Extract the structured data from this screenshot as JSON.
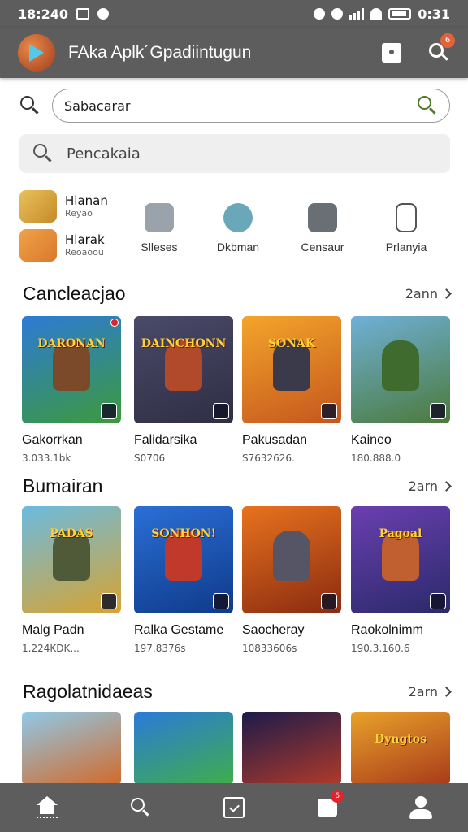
{
  "status_bar": {
    "time": "18:240",
    "right_time": "0:31"
  },
  "app_bar": {
    "title": "FAka Aplk´Gpadiintugun",
    "notification_count": "6"
  },
  "search": {
    "value": "Sabacarar",
    "secondary_placeholder": "Pencakaia"
  },
  "quick_links": [
    {
      "title": "Hlanan",
      "subtitle": "Reyao"
    },
    {
      "title": "Hlarak",
      "subtitle": "Reoaoou"
    }
  ],
  "categories": [
    {
      "label": "Slleses",
      "icon": "tag-icon"
    },
    {
      "label": "Dkbman",
      "icon": "refresh-icon"
    },
    {
      "label": "Censaur",
      "icon": "home-icon"
    },
    {
      "label": "Prlanyia",
      "icon": "tablet-icon"
    }
  ],
  "sections": [
    {
      "title": "Cancleacjao",
      "more": "2ann",
      "items": [
        {
          "name": "Gakorrkan",
          "meta": "3.033.1bk",
          "art_text": "DARONAN",
          "bg1": "#2d7ad6",
          "bg2": "#3c9a3c",
          "hero": "#7a4a2a"
        },
        {
          "name": "Falidarsika",
          "meta": "S0706",
          "art_text": "DAINCHONN",
          "bg1": "#4a4a6a",
          "bg2": "#2e2e44",
          "hero": "#b04a2a"
        },
        {
          "name": "Pakusadan",
          "meta": "S7632626.",
          "art_text": "SONAK",
          "bg1": "#f3a52a",
          "bg2": "#c5561e",
          "hero": "#3a3a4a"
        },
        {
          "name": "Kaineo",
          "meta": "180.888.0",
          "art_text": "",
          "bg1": "#6fb0d8",
          "bg2": "#4b7a3a",
          "hero": "#3f6b2f"
        }
      ]
    },
    {
      "title": "Bumairan",
      "more": "2arn",
      "items": [
        {
          "name": "Malg Padn",
          "meta": "1.224KDK...",
          "art_text": "PADAS",
          "bg1": "#6bbbe0",
          "bg2": "#d8a330",
          "hero": "#4e5a38"
        },
        {
          "name": "Ralka Gestame",
          "meta": "197.8376s",
          "art_text": "SONHON!",
          "bg1": "#2a6fd6",
          "bg2": "#0f3a8a",
          "hero": "#c0392b"
        },
        {
          "name": "Saocheray",
          "meta": "10833606s",
          "art_text": "",
          "bg1": "#e8731e",
          "bg2": "#8a2a10",
          "hero": "#555566"
        },
        {
          "name": "Raokolnimm",
          "meta": "190.3.160.6",
          "art_text": "Pagoal",
          "bg1": "#6a3fb0",
          "bg2": "#2a2a6a",
          "hero": "#c06030"
        }
      ]
    },
    {
      "title": "Ragolatnidaeas",
      "more": "2arn",
      "items": [
        {
          "bg1": "#8fc9e8",
          "bg2": "#d26a2a",
          "art_text": ""
        },
        {
          "bg1": "#2b7ad8",
          "bg2": "#3fae4a",
          "art_text": ""
        },
        {
          "bg1": "#1b1b4a",
          "bg2": "#b03a2a",
          "art_text": ""
        },
        {
          "bg1": "#e8a22a",
          "bg2": "#a83a1a",
          "art_text": "Dyngtos"
        }
      ]
    }
  ],
  "bottom_nav": [
    {
      "name": "home",
      "active": true
    },
    {
      "name": "search"
    },
    {
      "name": "tasks"
    },
    {
      "name": "messages",
      "badge": "6"
    },
    {
      "name": "profile"
    }
  ]
}
